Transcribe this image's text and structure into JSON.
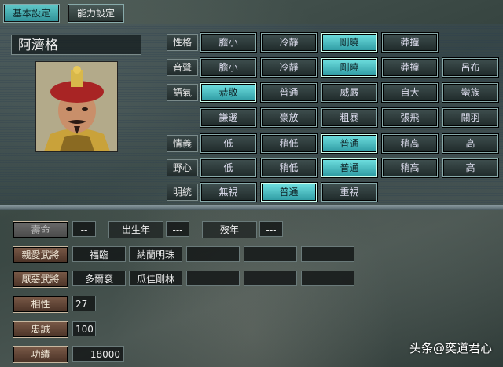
{
  "tabs": [
    "基本設定",
    "能力設定"
  ],
  "officer": {
    "name": "阿濟格"
  },
  "rows": [
    {
      "label": "性格",
      "options": [
        "膽小",
        "冷靜",
        "剛曉",
        "莽撞"
      ],
      "selected": 2
    },
    {
      "label": "音聲",
      "options": [
        "膽小",
        "冷靜",
        "剛曉",
        "莽撞",
        "呂布"
      ],
      "selected": 2
    },
    {
      "label": "語氣",
      "options": [
        "恭敬",
        "普通",
        "威嚴",
        "自大",
        "蠻族"
      ],
      "selected": 0
    },
    {
      "label": "",
      "options": [
        "謙遜",
        "豪放",
        "粗暴",
        "張飛",
        "關羽"
      ],
      "selected": -1
    },
    {
      "label": "情義",
      "options": [
        "低",
        "稍低",
        "普通",
        "稍高",
        "高"
      ],
      "selected": 2
    },
    {
      "label": "野心",
      "options": [
        "低",
        "稍低",
        "普通",
        "稍高",
        "高"
      ],
      "selected": 2
    },
    {
      "label": "明統",
      "options": [
        "無視",
        "普通",
        "重視"
      ],
      "selected": 1
    }
  ],
  "lifespan": {
    "label": "壽命",
    "value": "--"
  },
  "birth": {
    "label": "出生年",
    "value": "---"
  },
  "death": {
    "label": "歿年",
    "value": "---"
  },
  "beloved": {
    "label": "親愛武將",
    "names": [
      "福臨",
      "納蘭明珠",
      "",
      "",
      ""
    ]
  },
  "hated": {
    "label": "厭惡武將",
    "names": [
      "多爾袞",
      "瓜佳剛林",
      "",
      "",
      ""
    ]
  },
  "compat": {
    "label": "相性",
    "value": "27"
  },
  "loyalty": {
    "label": "忠誠",
    "value": "100"
  },
  "merit": {
    "label": "功績",
    "value": "18000"
  },
  "watermark": "头条@奕道君心"
}
